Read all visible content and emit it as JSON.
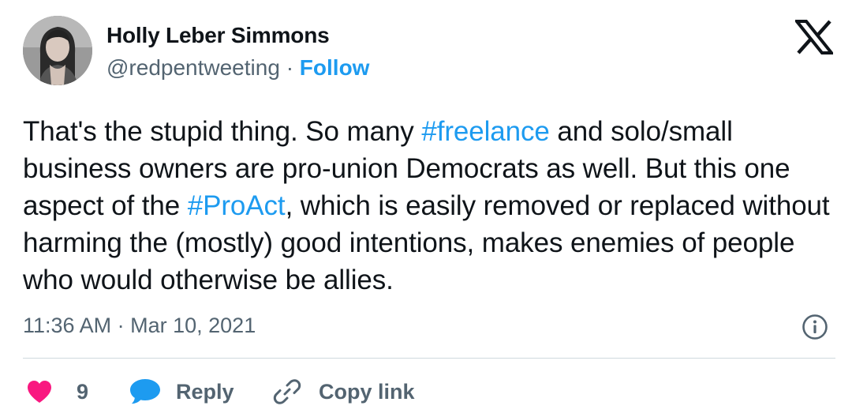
{
  "author": {
    "name": "Holly Leber Simmons",
    "handle": "@redpentweeting",
    "separator": "·",
    "follow_label": "Follow"
  },
  "tweet": {
    "text_parts": [
      {
        "text": "That's the stupid thing. So many "
      },
      {
        "text": "#freelance",
        "hashtag": true
      },
      {
        "text": " and solo/small business owners are pro-union Democrats as well. But this one aspect of the "
      },
      {
        "text": "#ProAct",
        "hashtag": true
      },
      {
        "text": ", which is easily removed or replaced without harming the (mostly) good intentions, makes enemies of people who would otherwise be allies."
      }
    ],
    "time": "11:36 AM",
    "dot": "·",
    "date": "Mar 10, 2021"
  },
  "actions": {
    "like_count": "9",
    "reply_label": "Reply",
    "copy_label": "Copy link"
  },
  "colors": {
    "accent": "#1d9bf0",
    "heart": "#f91880",
    "text": "#0f1419",
    "muted": "#536471",
    "divider": "#cfd9de"
  },
  "icons": [
    "x-logo-icon",
    "info-icon",
    "heart-icon",
    "reply-bubble-icon",
    "link-icon"
  ]
}
